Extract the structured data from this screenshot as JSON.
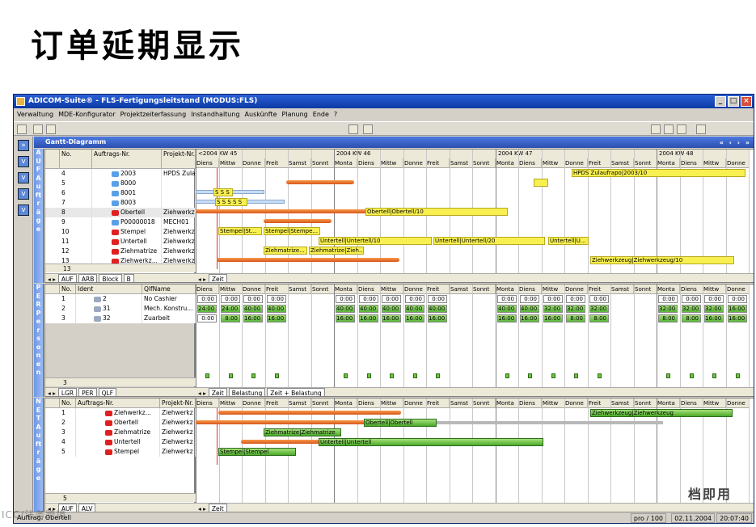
{
  "slide_title": "订单延期显示",
  "window": {
    "title": "ADICOM-Suite® - FLS-Fertigungsleitstand (MODUS:FLS)",
    "menu": [
      "Verwaltung",
      "MDE-Konfigurator",
      "Projektzeiterfassung",
      "Instandhaltung",
      "Auskünfte",
      "Planung",
      "Ende",
      "?"
    ]
  },
  "gantt_title": "Gantt-Diagramm",
  "weeks": [
    "<2004 KW 45",
    "2004 KW 46",
    "2004 KW 47",
    "2004 KW 48"
  ],
  "days": [
    "Diens",
    "Mittw",
    "Donne",
    "Freit",
    "Samst",
    "Sonnt",
    "Monta",
    "Diens",
    "Mittw",
    "Donne",
    "Freit",
    "Samst",
    "Sonnt",
    "Monta",
    "Diens",
    "Mittw",
    "Donne",
    "Freit",
    "Samst",
    "Sonnt",
    "Monta",
    "Diens",
    "Mittw",
    "Donne"
  ],
  "auf": {
    "strip": "AUFAufträge",
    "headers": {
      "no": "No.",
      "order": "Auftrags-Nr.",
      "project": "Projekt-Nr."
    },
    "rows": [
      {
        "no": "4",
        "order": "2003",
        "project": "HPDS Zulauf..."
      },
      {
        "no": "5",
        "order": "8000",
        "project": ""
      },
      {
        "no": "6",
        "order": "8001",
        "project": ""
      },
      {
        "no": "7",
        "order": "8003",
        "project": ""
      },
      {
        "no": "8",
        "order": "Obertell",
        "project": "Ziehwerkz"
      },
      {
        "no": "9",
        "order": "P00000018",
        "project": "MECH01"
      },
      {
        "no": "10",
        "order": "Stempel",
        "project": "Ziehwerkz"
      },
      {
        "no": "11",
        "order": "Untertell",
        "project": "Ziehwerkz"
      },
      {
        "no": "12",
        "order": "Ziehmatrize",
        "project": "Ziehwerkz"
      },
      {
        "no": "13",
        "order": "Ziehwerkz...",
        "project": "Ziehwerkz"
      }
    ],
    "count": "13",
    "tabs": [
      "AUF",
      "ARB",
      "Block",
      "B"
    ],
    "right_tab": "Zeit",
    "bar_labels": {
      "hpds": "HPDS Zulaufrapo|2003/10",
      "s1": "S S S",
      "s2": "S S S S S",
      "obertell": "Obertell|Obertell/10",
      "stempel1": "Stempel|St...",
      "stempel2": "Stempel|Stempe...",
      "untertell1": "Untertell|Untertell/10",
      "untertell2": "Untertell|Untertell/20",
      "untertell3": "Untertell|U...",
      "ziehm1": "Ziehmatrize...",
      "ziehm2": "Ziehmatrize|Zieh...",
      "ziehwz": "Ziehwerkzeug|Ziehwerkzeug/10"
    }
  },
  "per": {
    "strip": "PERPersonen",
    "headers": {
      "no": "No.",
      "ident": "Ident",
      "qual": "QlfName"
    },
    "rows": [
      {
        "no": "1",
        "ident": "2",
        "qual": "No Cashier"
      },
      {
        "no": "2",
        "ident": "31",
        "qual": "Mech. Konstru..."
      },
      {
        "no": "3",
        "ident": "32",
        "qual": "Zuarbeit"
      }
    ],
    "cap": [
      [
        "0:00",
        "0:00",
        "0:00",
        "0:00",
        "",
        "",
        "0:00",
        "0:00",
        "0:00",
        "0:00",
        "0:00",
        "",
        "",
        "0:00",
        "0:00",
        "0:00",
        "0:00",
        "0:00",
        "",
        "",
        "0:00",
        "0:00",
        "0:00",
        "0:00"
      ],
      [
        "24:00",
        "24:00",
        "40:00",
        "40:00",
        "",
        "",
        "40:00",
        "40:00",
        "40:00",
        "40:00",
        "40:00",
        "",
        "",
        "40:00",
        "40:00",
        "32:00",
        "32:00",
        "32:00",
        "",
        "",
        "32:00",
        "32:00",
        "32:00",
        "16:00"
      ],
      [
        "0:00",
        "8:00",
        "16:00",
        "16:00",
        "",
        "",
        "16:00",
        "16:00",
        "16:00",
        "16:00",
        "16:00",
        "",
        "",
        "16:00",
        "16:00",
        "16:00",
        "8:00",
        "8:00",
        "",
        "",
        "8:00",
        "8:00",
        "16:00",
        "16:00"
      ]
    ],
    "count": "3",
    "tabs": [
      "LGR",
      "PER",
      "QLF"
    ],
    "right_tabs": [
      "Zeit",
      "Belastung",
      "Zeit + Belastung"
    ]
  },
  "net": {
    "strip": "NETAufträge",
    "headers": {
      "no": "No.",
      "order": "Auftrags-Nr.",
      "project": "Projekt-Nr."
    },
    "rows": [
      {
        "no": "1",
        "order": "Ziehwerkz...",
        "project": "Ziehwerkz"
      },
      {
        "no": "2",
        "order": "Obertell",
        "project": "Ziehwerkz"
      },
      {
        "no": "3",
        "order": "Ziehmatrize",
        "project": "Ziehwerkz"
      },
      {
        "no": "4",
        "order": "Untertell",
        "project": "Ziehwerkz"
      },
      {
        "no": "5",
        "order": "Stempel",
        "project": "Ziehwerkz"
      }
    ],
    "count": "5",
    "tabs": [
      "AUF",
      "ALV"
    ],
    "right_tab": "Zeit",
    "bar_labels": {
      "ziehwz": "Ziehwerkzeug|Ziehwerkzeug",
      "obertell": "Obertell|Obertell",
      "ziehm": "Ziehmatrize|Ziehmatrize",
      "untertell": "Untertell|Untertell",
      "stempel": "Stempel|Stempel"
    }
  },
  "status": {
    "left": "Auftrag: Obertell",
    "user": "pro / 100",
    "date": "02.11.2004",
    "time": "20:07:40"
  },
  "watermarks": {
    "br": "档即用",
    "bl": "ICC/法务跨境"
  }
}
